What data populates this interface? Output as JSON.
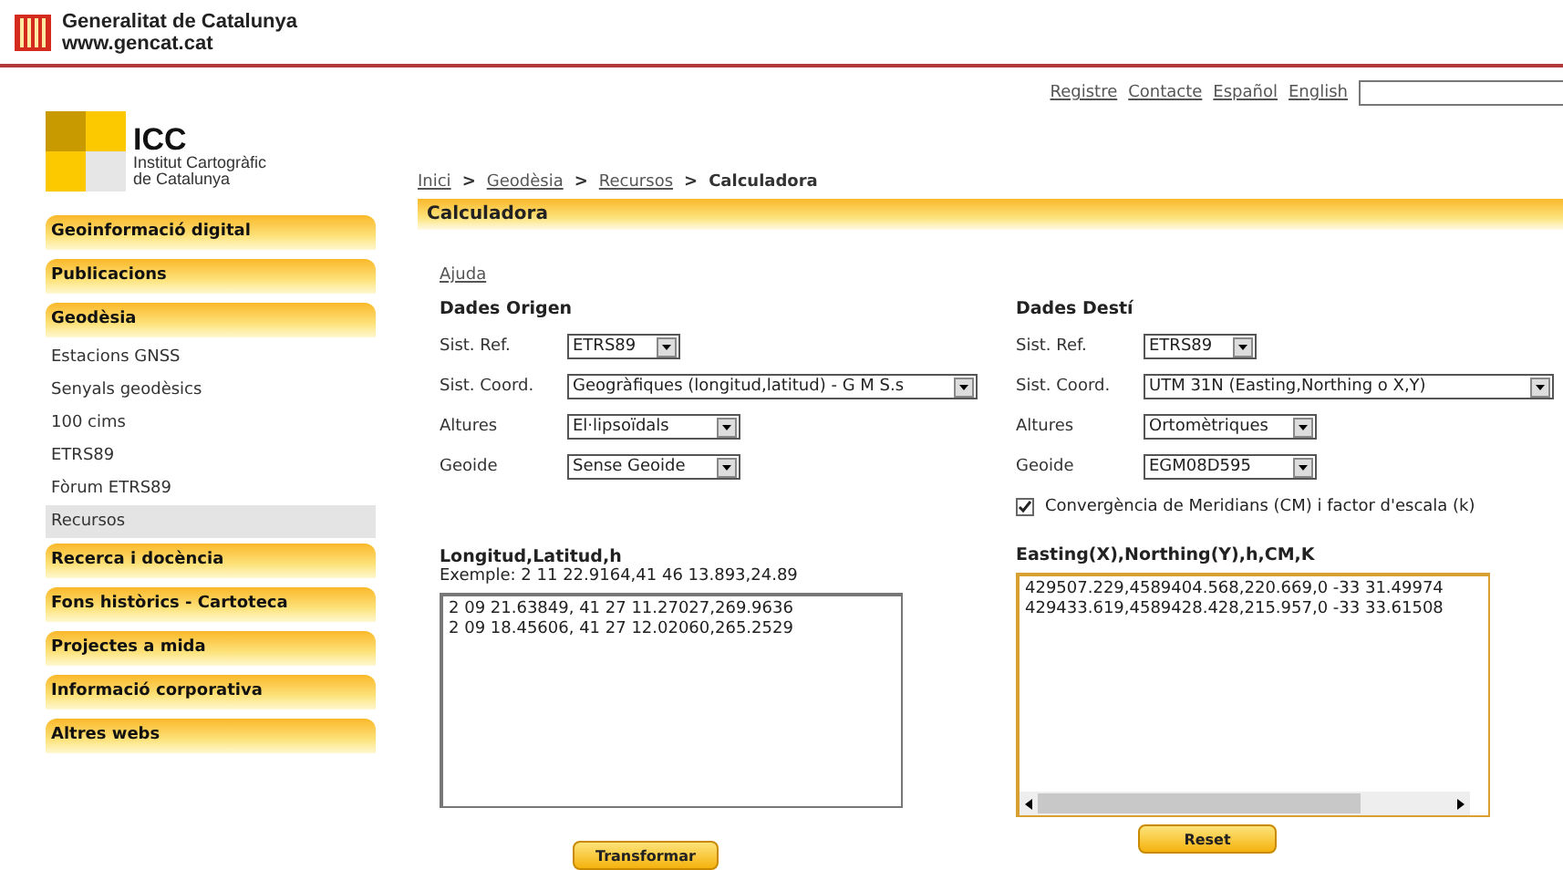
{
  "header": {
    "org_name": "Generalitat de Catalunya",
    "org_url": "www.gencat.cat"
  },
  "top_links": [
    "Registre",
    "Contacte",
    "Español",
    "English"
  ],
  "logo": {
    "title": "ICC",
    "subtitle_1": "Institut Cartogràfic",
    "subtitle_2": "de Catalunya"
  },
  "breadcrumb": [
    {
      "label": "Inici",
      "kind": "link"
    },
    {
      "label": ">",
      "kind": "text"
    },
    {
      "label": "Geodèsia",
      "kind": "link"
    },
    {
      "label": ">",
      "kind": "text"
    },
    {
      "label": "Recursos",
      "kind": "link"
    },
    {
      "label": ">",
      "kind": "text"
    },
    {
      "label": "Calculadora",
      "kind": "text"
    }
  ],
  "sidebar": {
    "items": [
      {
        "kind": "section",
        "label": "Geoinformació digital",
        "selected": false
      },
      {
        "kind": "section",
        "label": "Publicacions",
        "selected": false
      },
      {
        "kind": "section",
        "label": "Geodèsia",
        "selected": false
      },
      {
        "kind": "link",
        "label": "Estacions GNSS",
        "selected": false
      },
      {
        "kind": "link",
        "label": "Senyals geodèsics",
        "selected": false
      },
      {
        "kind": "link",
        "label": "100 cims",
        "selected": false
      },
      {
        "kind": "link",
        "label": "ETRS89",
        "selected": false
      },
      {
        "kind": "link",
        "label": "Fòrum ETRS89",
        "selected": false
      },
      {
        "kind": "link",
        "label": "Recursos",
        "selected": true
      },
      {
        "kind": "section",
        "label": "Recerca i docència",
        "selected": false
      },
      {
        "kind": "section",
        "label": "Fons històrics - Cartoteca",
        "selected": false
      },
      {
        "kind": "section",
        "label": "Projectes a mida",
        "selected": false
      },
      {
        "kind": "section",
        "label": "Informació corporativa",
        "selected": false
      },
      {
        "kind": "section",
        "label": "Altres webs",
        "selected": false
      }
    ]
  },
  "page_title": "Calculadora",
  "help_link": "Ajuda",
  "origin": {
    "title": "Dades Origen",
    "fields": [
      {
        "label": "Sist. Ref.",
        "value": "ETRS89"
      },
      {
        "label": "Sist. Coord.",
        "value": "Geogràfiques (longitud,latitud) - G M S.s"
      },
      {
        "label": "Altures",
        "value": "El·lipsoïdals"
      },
      {
        "label": "Geoide",
        "value": "Sense Geoide"
      }
    ],
    "input_title": "Longitud,Latitud,h",
    "example": "Exemple: 2 11 22.9164,41 46 13.893,24.89",
    "lines": [
      "2 09 21.63849, 41 27 11.27027,269.9636",
      "2 09 18.45606, 41 27 12.02060,265.2529"
    ],
    "button": "Transformar"
  },
  "destination": {
    "title": "Dades Destí",
    "fields": [
      {
        "label": "Sist. Ref.",
        "value": "ETRS89"
      },
      {
        "label": "Sist. Coord.",
        "value": "UTM 31N (Easting,Northing o X,Y)"
      },
      {
        "label": "Altures",
        "value": "Ortomètriques"
      },
      {
        "label": "Geoide",
        "value": "EGM08D595"
      }
    ],
    "checkbox": {
      "label": "Convergència de Meridians (CM) i factor d'escala (k)",
      "checked": true
    },
    "output_title": "Easting(X),Northing(Y),h,CM,K",
    "lines": [
      "429507.229,4589404.568,220.669,0 -33 31.49974",
      "429433.619,4589428.428,215.957,0 -33 33.61508"
    ],
    "button": "Reset"
  }
}
